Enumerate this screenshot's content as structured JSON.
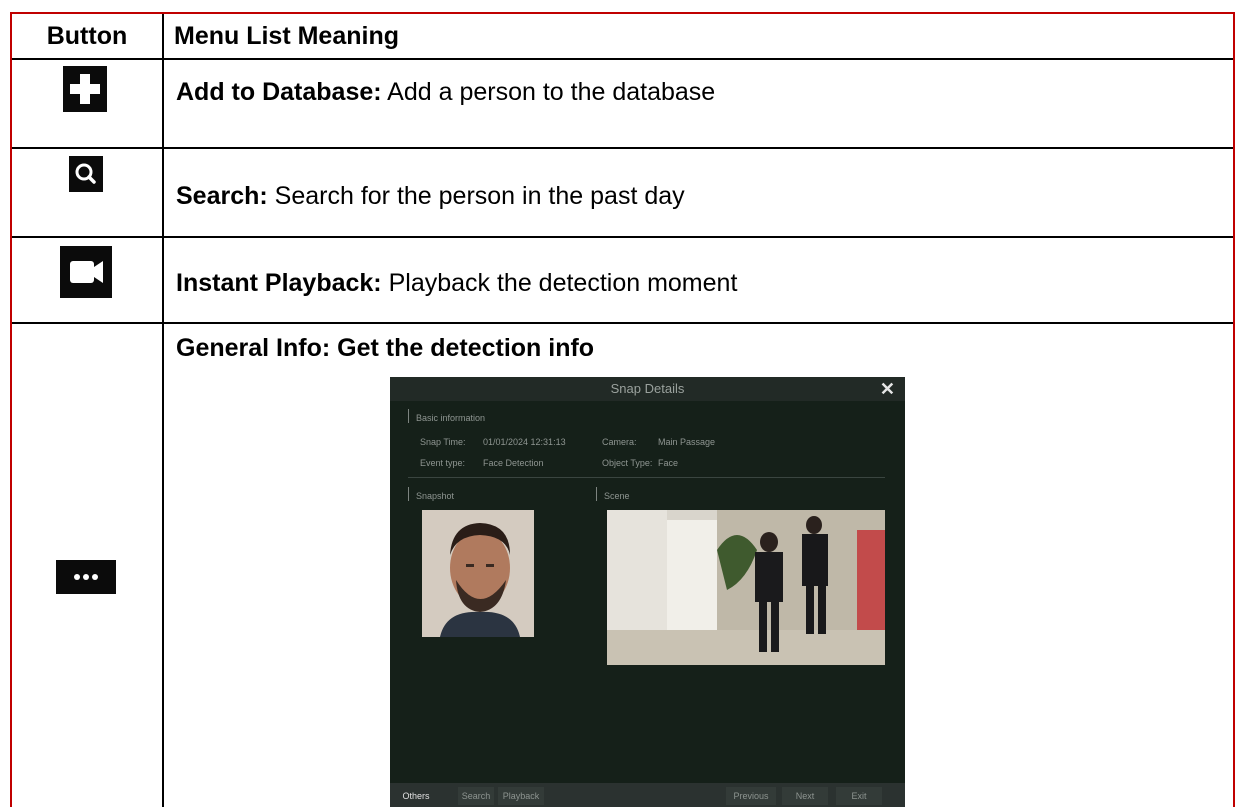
{
  "table": {
    "headers": {
      "button": "Button",
      "meaning": "Menu List Meaning"
    },
    "rows": [
      {
        "icon": "plus-icon",
        "term": "Add to Database:",
        "desc": " Add a person to the database"
      },
      {
        "icon": "search-icon",
        "term": "Search:",
        "desc": " Search for the person in the past day"
      },
      {
        "icon": "video-camera-icon",
        "term": "Instant Playback:",
        "desc": " Playback the detection moment"
      },
      {
        "icon": "ellipsis-icon",
        "heading": "General Info: Get the detection info"
      }
    ]
  },
  "dialog": {
    "title": "Snap Details",
    "close": "✕",
    "section_basic": "Basic information",
    "snap_time_label": "Snap Time:",
    "snap_time_value": "01/01/2024 12:31:13",
    "camera_label": "Camera:",
    "camera_value": "Main Passage",
    "event_type_label": "Event type:",
    "event_type_value": "Face Detection",
    "object_type_label": "Object Type:",
    "object_type_value": "Face",
    "snapshot_label": "Snapshot",
    "scene_label": "Scene",
    "footer": {
      "others": "Others",
      "search": "Search",
      "playback": "Playback",
      "previous": "Previous",
      "next": "Next",
      "exit": "Exit"
    }
  },
  "colors": {
    "table_border": "#c00000",
    "dialog_bg": "#152019"
  }
}
